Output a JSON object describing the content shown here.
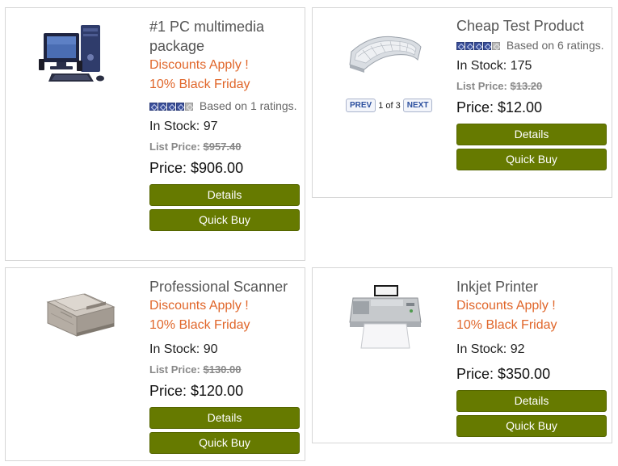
{
  "products": [
    {
      "title": "#1 PC multimedia package",
      "promo_line1": "Discounts Apply !",
      "promo_line2": "10% Black Friday",
      "rating_text": "Based on 1 ratings.",
      "rating_stars": 4,
      "stock_label": "In Stock: 97",
      "list_label": "List Price:",
      "list_value": "$957.40",
      "price": "Price: $906.00",
      "details_label": "Details",
      "quickbuy_label": "Quick Buy"
    },
    {
      "title": "Cheap Test Product",
      "rating_text": "Based on 6 ratings.",
      "rating_stars": 4,
      "stock_label": "In Stock: 175",
      "list_label": "List Price:",
      "list_value": "$13.20",
      "price": "Price: $12.00",
      "details_label": "Details",
      "quickbuy_label": "Quick Buy",
      "pager": {
        "prev": "PREV",
        "status": "1 of 3",
        "next": "NEXT"
      }
    },
    {
      "title": "Professional Scanner",
      "promo_line1": "Discounts Apply !",
      "promo_line2": "10% Black Friday",
      "stock_label": "In Stock: 90",
      "list_label": "List Price:",
      "list_value": "$130.00",
      "price": "Price: $120.00",
      "details_label": "Details",
      "quickbuy_label": "Quick Buy"
    },
    {
      "title": "Inkjet Printer",
      "promo_line1": "Discounts Apply !",
      "promo_line2": "10% Black Friday",
      "stock_label": "In Stock: 92",
      "price": "Price: $350.00",
      "details_label": "Details",
      "quickbuy_label": "Quick Buy"
    }
  ],
  "colors": {
    "button_bg": "#667a00",
    "promo": "#e0662a",
    "star_on": "#3a4f9a",
    "star_off": "#b9b9b9"
  },
  "icons": [
    "desktop-pc-image",
    "keyboard-image",
    "scanner-image",
    "inkjet-printer-image",
    "rating-star-icon"
  ]
}
